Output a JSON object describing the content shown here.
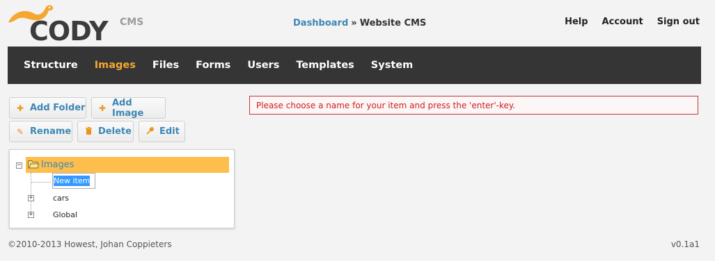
{
  "logo": {
    "text": "CODY",
    "suffix": "CMS"
  },
  "breadcrumb": {
    "link": "Dashboard",
    "separator": "»",
    "current": "Website CMS"
  },
  "top_links": {
    "help": "Help",
    "account": "Account",
    "signout": "Sign out"
  },
  "nav": [
    {
      "label": "Structure",
      "active": false
    },
    {
      "label": "Images",
      "active": true
    },
    {
      "label": "Files",
      "active": false
    },
    {
      "label": "Forms",
      "active": false
    },
    {
      "label": "Users",
      "active": false
    },
    {
      "label": "Templates",
      "active": false
    },
    {
      "label": "System",
      "active": false
    }
  ],
  "toolbar": {
    "add_folder": "Add Folder",
    "add_image": "Add Image",
    "rename": "Rename",
    "delete": "Delete",
    "edit": "Edit"
  },
  "tree": {
    "root": "Images",
    "new_item_value": "New item",
    "children": [
      "cars",
      "Global"
    ]
  },
  "message": "Please choose a name for your item and press the 'enter'-key.",
  "footer": {
    "copyright": "©2010-2013 Howest, Johan Coppieters",
    "version": "v0.1a1"
  },
  "colors": {
    "accent": "#f6a732",
    "link": "#3d87b5",
    "nav_bg": "#353535",
    "error": "#cc1f22"
  }
}
